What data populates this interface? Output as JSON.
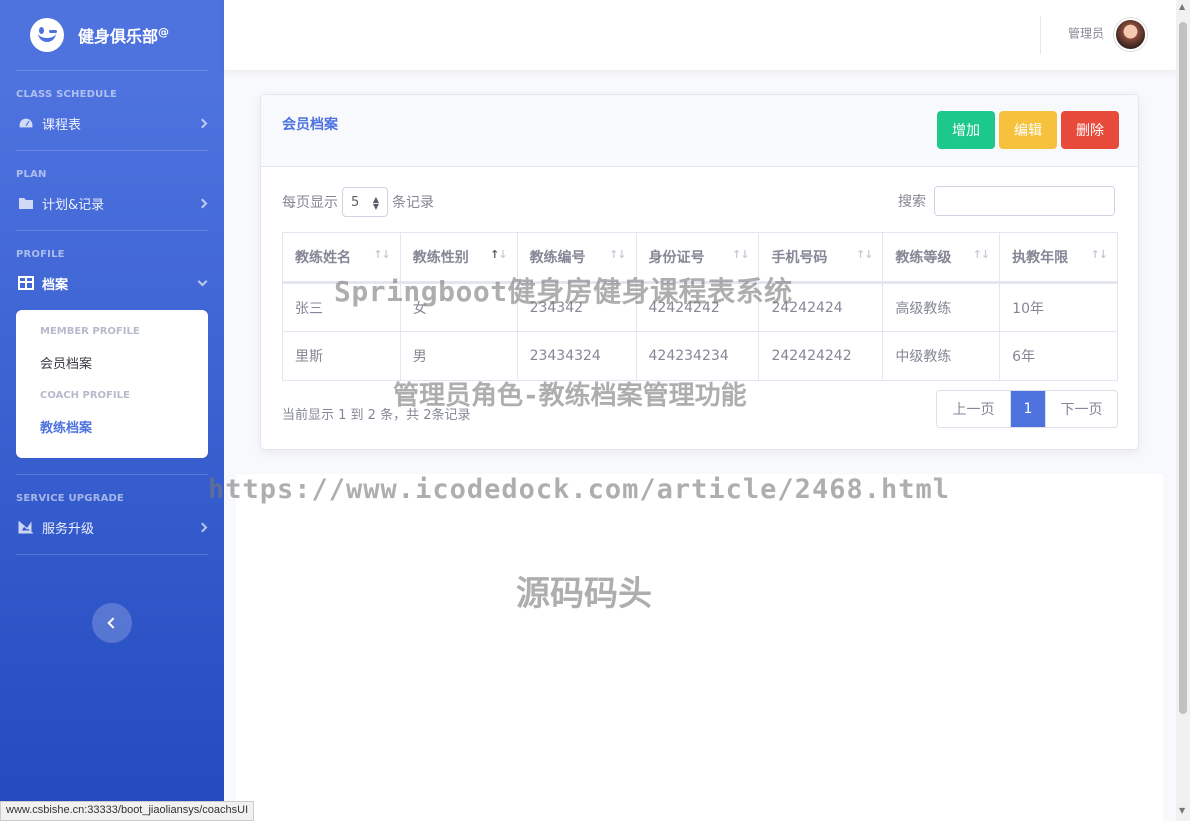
{
  "sidebar": {
    "brand": "健身俱乐部",
    "brand_sup": "@",
    "sections": [
      {
        "heading": "CLASS SCHEDULE",
        "item": "课程表"
      },
      {
        "heading": "PLAN",
        "item": "计划&记录"
      },
      {
        "heading": "PROFILE",
        "item": "档案"
      },
      {
        "heading": "SERVICE UPGRADE",
        "item": "服务升级"
      }
    ],
    "submenu": {
      "member_heading": "MEMBER PROFILE",
      "member_item": "会员档案",
      "coach_heading": "COACH PROFILE",
      "coach_item": "教练档案"
    }
  },
  "topbar": {
    "user": "管理员"
  },
  "card": {
    "title": "会员档案",
    "buttons": {
      "add": "增加",
      "edit": "编辑",
      "delete": "删除"
    },
    "length_prefix": "每页显示",
    "length_value": "5",
    "length_suffix": "条记录",
    "search_label": "搜索",
    "columns": [
      "教练姓名",
      "教练性别",
      "教练编号",
      "身份证号",
      "手机号码",
      "教练等级",
      "执教年限"
    ],
    "rows": [
      [
        "张三",
        "女",
        "234342",
        "42424242",
        "24242424",
        "高级教练",
        "10年"
      ],
      [
        "里斯",
        "男",
        "23434324",
        "424234234",
        "242424242",
        "中级教练",
        "6年"
      ]
    ],
    "info": "当前显示 1 到 2 条，共 2条记录",
    "pager": {
      "prev": "上一页",
      "current": "1",
      "next": "下一页"
    }
  },
  "watermarks": {
    "line1": "Springboot健身房健身课程表系统",
    "line2": "管理员角色-教练档案管理功能",
    "line3": "https://www.icodedock.com/article/2468.html",
    "line4": "源码码头"
  },
  "statusbar": "www.csbishe.cn:33333/boot_jiaoliansys/coachsUI"
}
